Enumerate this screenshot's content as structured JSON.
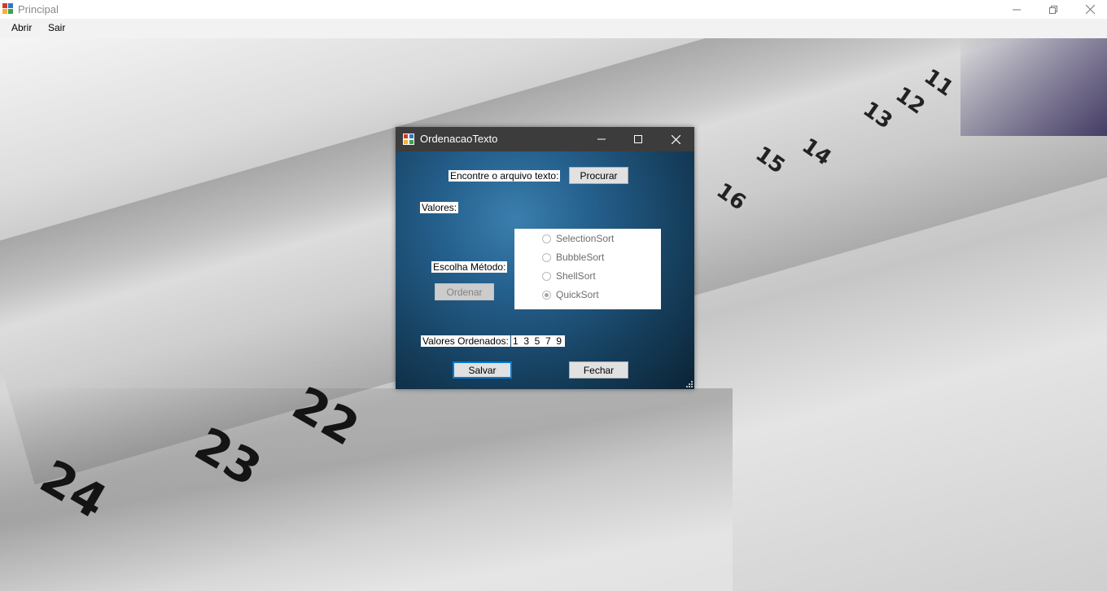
{
  "main_window": {
    "title": "Principal",
    "menu": [
      "Abrir",
      "Sair"
    ]
  },
  "background": {
    "tab_numbers": [
      "24",
      "23",
      "22",
      "16",
      "15",
      "14",
      "13",
      "12",
      "11"
    ]
  },
  "dialog": {
    "title": "OrdenacaoTexto",
    "find_label": "Encontre o arquivo texto:",
    "browse_button": "Procurar",
    "values_label": "Valores:",
    "method_label": "Escolha Método:",
    "sort_button": "Ordenar",
    "sort_options": [
      {
        "label": "SelectionSort",
        "checked": false
      },
      {
        "label": "BubbleSort",
        "checked": false
      },
      {
        "label": "ShellSort",
        "checked": false
      },
      {
        "label": "QuickSort",
        "checked": true
      }
    ],
    "sorted_label": "Valores Ordenados:",
    "sorted_values": "1  3  5  7  9",
    "save_button": "Salvar",
    "close_button": "Fechar"
  },
  "colors": {
    "dialog_title_bar": "#3c3c3c",
    "dialog_bg_center": "#3b7fae",
    "dialog_bg_edge": "#0b2334",
    "focus_border": "#0078d7"
  }
}
